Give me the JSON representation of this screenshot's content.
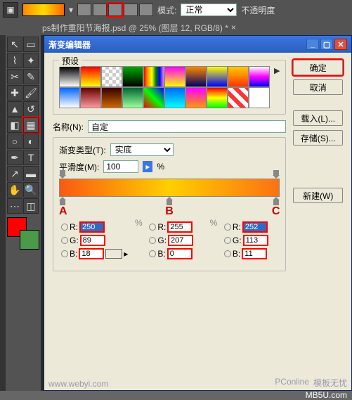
{
  "toolbar": {
    "mode_label": "模式:",
    "mode_value": "正常",
    "opacity_label": "不透明度"
  },
  "tab": {
    "title": "ps制作重阳节海报.psd @ 25% (图层 12, RGB/8) *"
  },
  "dialog": {
    "title": "渐变编辑器",
    "preset_label": "预设",
    "name_label": "名称(N):",
    "name_value": "自定",
    "grad_type_label": "渐变类型(T):",
    "grad_type_value": "实底",
    "smoothness_label": "平滑度(M):",
    "smoothness_value": "100",
    "percent": "%",
    "buttons": {
      "ok": "确定",
      "cancel": "取消",
      "load": "载入(L)...",
      "save": "存储(S)...",
      "new": "新建(W)"
    },
    "markers": {
      "a": "A",
      "b": "B",
      "c": "C"
    },
    "stops": {
      "a": {
        "r": "250",
        "g": "89",
        "b": "18"
      },
      "b": {
        "r": "255",
        "g": "207",
        "b": "0"
      },
      "c": {
        "r": "252",
        "g": "113",
        "b": "11"
      }
    },
    "rgb_labels": {
      "r": "R:",
      "g": "G:",
      "b": "B:"
    },
    "chip_color_a": "#fa5912"
  },
  "watermark": {
    "left": "www.webyi.com",
    "right": "模板无忧",
    "mid": "PConline",
    "site": "MB5U.com"
  }
}
